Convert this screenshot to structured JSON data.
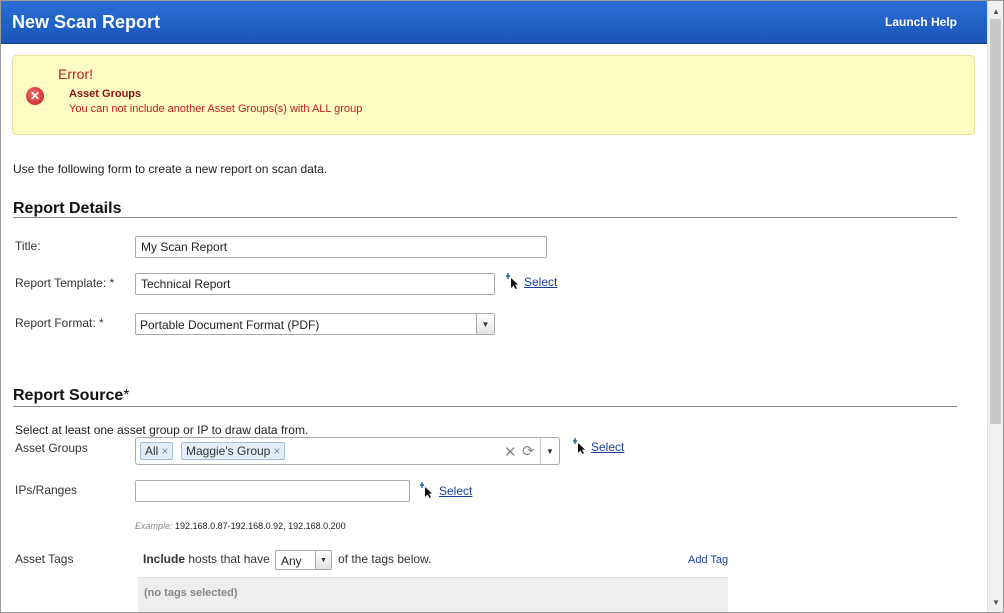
{
  "window": {
    "title": "New Scan Report",
    "help_label": "Launch Help"
  },
  "error": {
    "title": "Error!",
    "field": "Asset Groups",
    "message": "You can not include another Asset Groups(s) with ALL group",
    "icon": "error-x-icon"
  },
  "intro_text": "Use the following form to create a new report on scan data.",
  "report_details": {
    "heading": "Report Details",
    "title_label": "Title:",
    "title_value": "My Scan Report",
    "template_label": "Report Template: *",
    "template_value": "Technical Report",
    "template_select_label": "Select",
    "format_label": "Report Format: *",
    "format_value": "Portable Document Format (PDF)"
  },
  "report_source": {
    "heading": "Report Source",
    "heading_required": "*",
    "hint": "Select at least one asset group or IP to draw data from.",
    "asset_groups_label": "Asset Groups",
    "asset_groups": [
      {
        "label": "All",
        "remove": "×"
      },
      {
        "label": "Maggie's Group",
        "remove": "×"
      }
    ],
    "clear_symbol": "✕",
    "reload_symbol": "⟳",
    "asset_groups_select_label": "Select",
    "ips_label": "IPs/Ranges",
    "ips_value": "",
    "ips_select_label": "Select",
    "example_prefix": "Example:",
    "example_value": " 192.168.0.87-192.168.0.92, 192.168.0.200",
    "asset_tags_label": "Asset Tags",
    "tags_include_bold": "Include",
    "tags_include_rest": " hosts that have",
    "tags_match_value": "Any",
    "tags_after": "of the tags below.",
    "add_tag_label": "Add Tag",
    "no_tags_text": "(no tags selected)"
  },
  "colors": {
    "titlebar": "#1a55b8",
    "error_bg": "#fdfdc2",
    "error_text": "#c41c1c",
    "link": "#1a3fa0"
  }
}
